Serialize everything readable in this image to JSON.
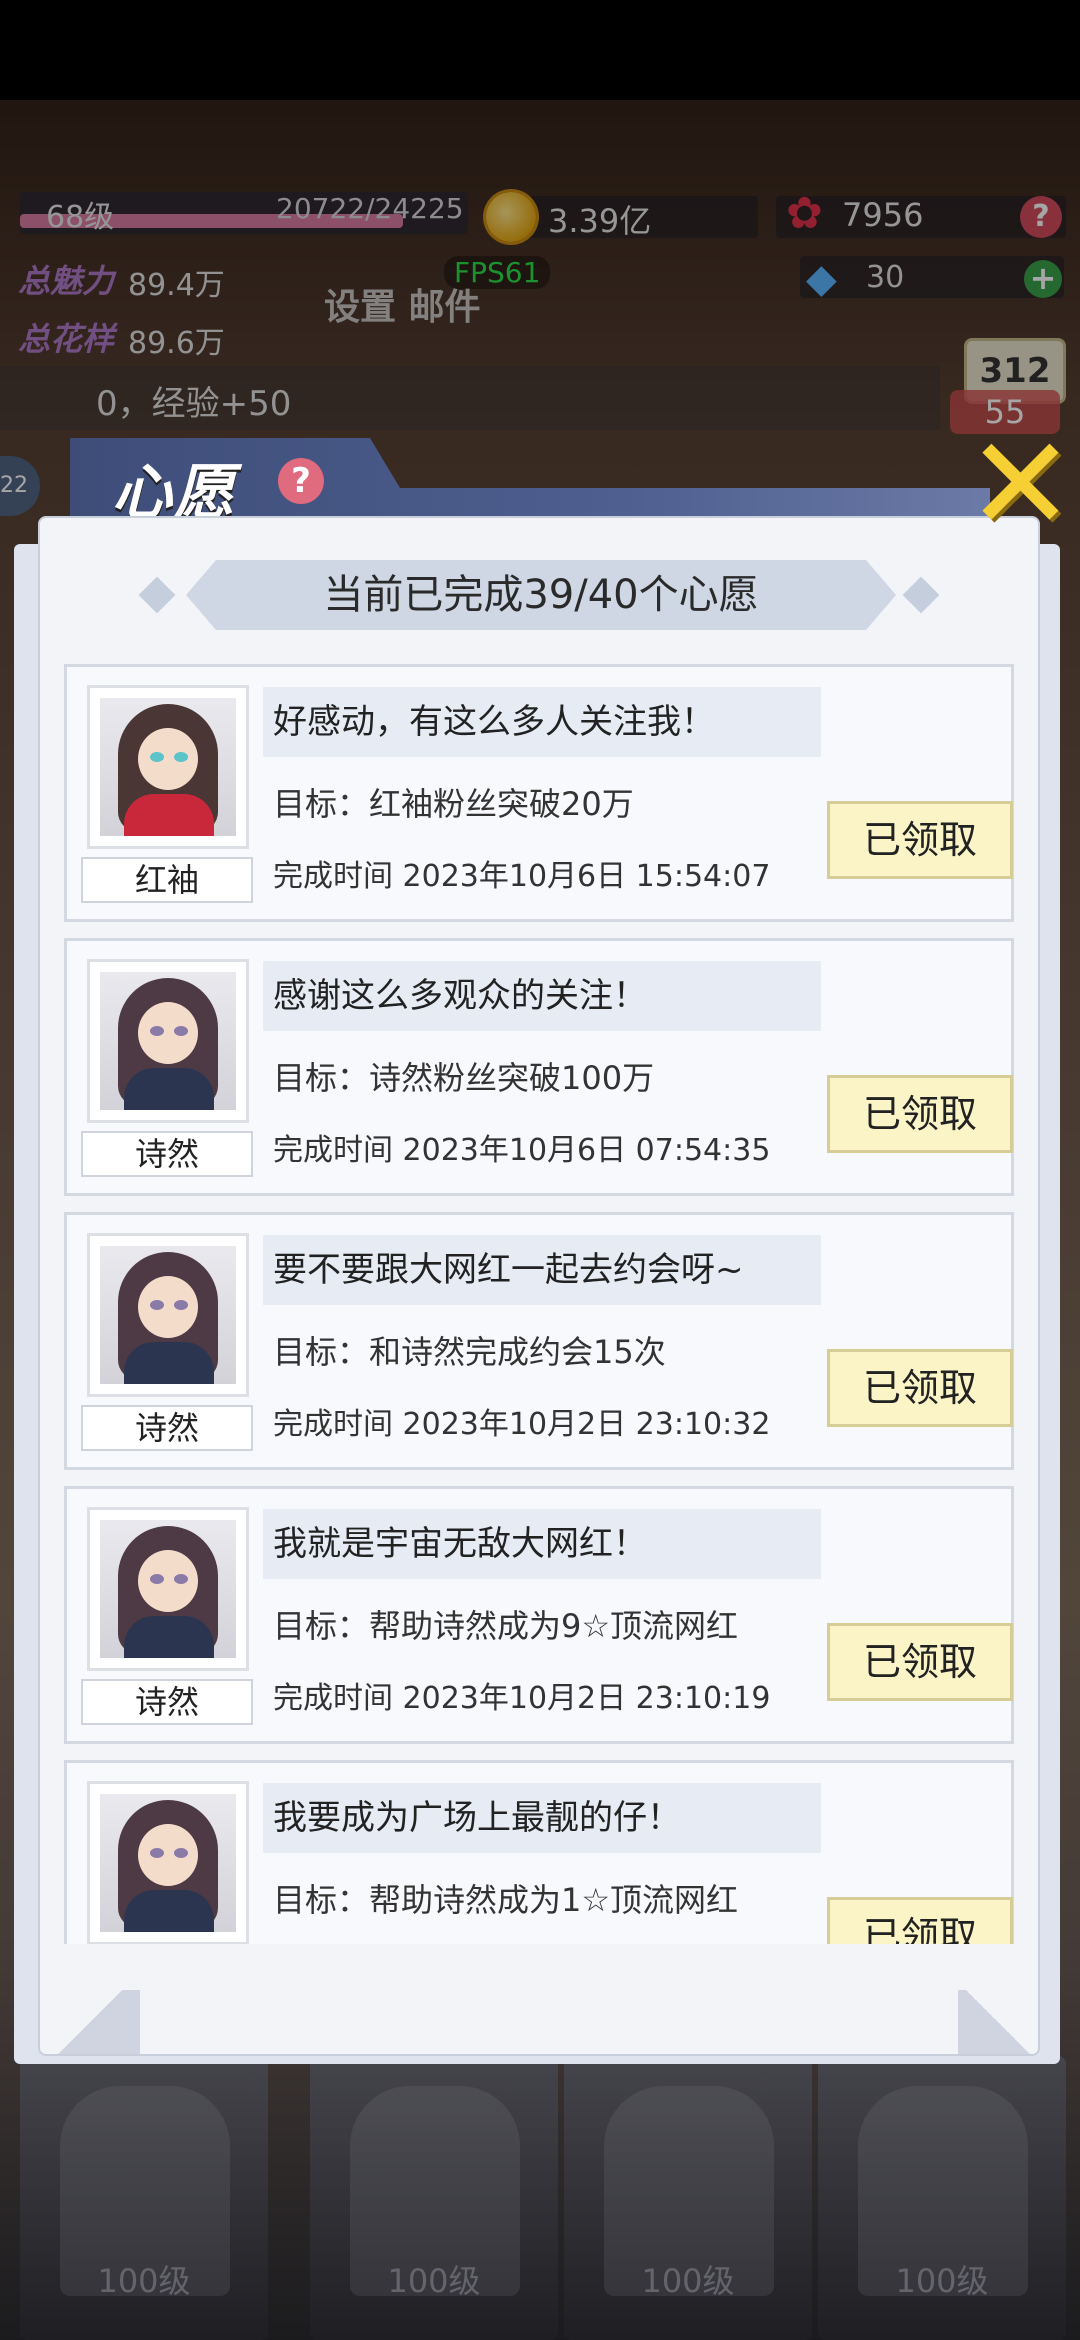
{
  "hud": {
    "level": "68级",
    "exp": "20722/24225",
    "exp_fraction": 0.855,
    "coins": "3.39亿",
    "roses": "7956",
    "charm_label": "总魅力",
    "charm_value": "89.4万",
    "flower_label": "总花样",
    "flower_value": "89.6万",
    "fps": "FPS61",
    "settings_mail": "设置 邮件",
    "diamonds": "30",
    "exp_note": "0，经验+50",
    "rank_board": "312",
    "rank_value": "55",
    "side_badge": "22",
    "help_glyph": "?",
    "plus_glyph": "+"
  },
  "modal": {
    "title": "心愿",
    "help_glyph": "?",
    "close_glyph": "✕",
    "progress": "当前已完成39/40个心愿"
  },
  "wishes": [
    {
      "name": "红袖",
      "quote": "好感动，有这么多人关注我！",
      "goal": "目标：红袖粉丝突破20万",
      "time": "完成时间 2023年10月6日  15:54:07",
      "button": "已领取",
      "hair": "#4a3634",
      "outfit": "#c8283a",
      "eyes": "#5cc3c9"
    },
    {
      "name": "诗然",
      "quote": "感谢这么多观众的关注！",
      "goal": "目标：诗然粉丝突破100万",
      "time": "完成时间 2023年10月6日  07:54:35",
      "button": "已领取",
      "hair": "#4e3a44",
      "outfit": "#2c3550",
      "eyes": "#8a7aa8"
    },
    {
      "name": "诗然",
      "quote": "要不要跟大网红一起去约会呀~",
      "goal": "目标：和诗然完成约会15次",
      "time": "完成时间 2023年10月2日  23:10:32",
      "button": "已领取",
      "hair": "#4e3a44",
      "outfit": "#2c3550",
      "eyes": "#8a7aa8"
    },
    {
      "name": "诗然",
      "quote": "我就是宇宙无敌大网红！",
      "goal": "目标：帮助诗然成为9☆顶流网红",
      "time": "完成时间 2023年10月2日  23:10:19",
      "button": "已领取",
      "hair": "#4e3a44",
      "outfit": "#2c3550",
      "eyes": "#8a7aa8"
    },
    {
      "name": "诗然",
      "quote": "我要成为广场上最靓的仔！",
      "goal": "目标：帮助诗然成为1☆顶流网红",
      "time": "",
      "button": "已领取",
      "hair": "#4e3a44",
      "outfit": "#2c3550",
      "eyes": "#8a7aa8"
    }
  ],
  "bottom_cards": [
    {
      "level": "100级"
    },
    {
      "level": "100级"
    },
    {
      "level": "100级"
    },
    {
      "level": "100级"
    }
  ]
}
